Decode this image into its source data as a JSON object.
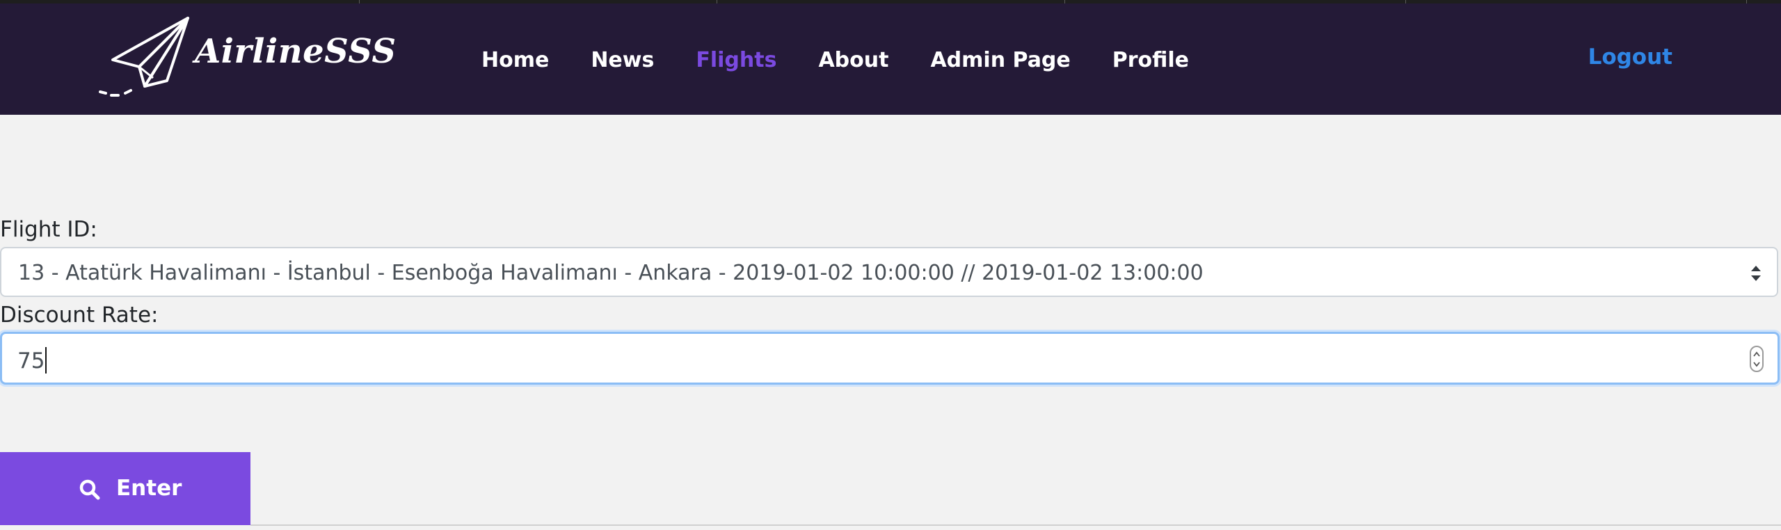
{
  "brand": {
    "name": "AirlineSSS"
  },
  "nav": {
    "items": [
      {
        "label": "Home"
      },
      {
        "label": "News"
      },
      {
        "label": "Flights"
      },
      {
        "label": "About"
      },
      {
        "label": "Admin Page"
      },
      {
        "label": "Profile"
      }
    ],
    "active": "Flights",
    "logout_label": "Logout"
  },
  "form": {
    "flight_label": "Flight ID:",
    "flight_selected": "13 - Atatürk Havalimanı - İstanbul - Esenboğa Havalimanı - Ankara - 2019-01-02 10:00:00 // 2019-01-02 13:00:00",
    "discount_label": "Discount Rate:",
    "discount_value": "75",
    "submit_label": "Enter"
  },
  "colors": {
    "header_bg": "#241a37",
    "accent": "#7b4ae0",
    "logout": "#2f86e6",
    "page_bg": "#f2f2f2"
  },
  "icons": {
    "logo": "paper-plane-icon",
    "select": "select-arrows-icon",
    "spinner": "number-spinner-icon",
    "submit": "search-icon"
  }
}
